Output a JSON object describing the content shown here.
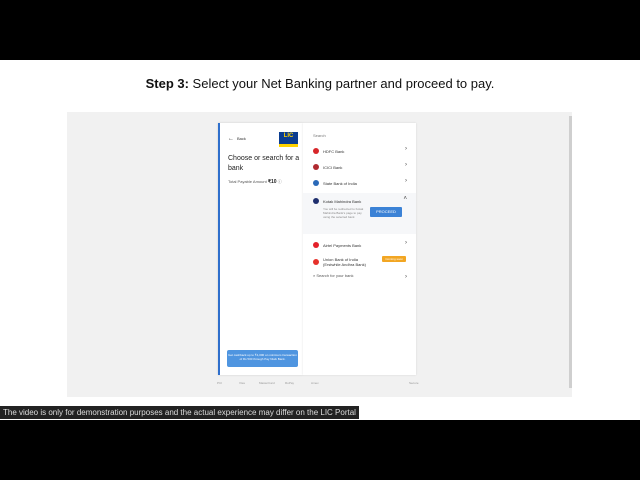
{
  "step": {
    "prefix": "Step 3:",
    "text": " Select your Net Banking partner and proceed to pay."
  },
  "left": {
    "back_label": "Back",
    "logo_text": "LIC",
    "title": "Choose or search for a bank",
    "amount_label": "Total Payable Amount",
    "amount_value": "₹10",
    "notice": "Get cashback up to ₹1,000 on minimum transaction of Rs 500 through Pay Ntwk Bank."
  },
  "right": {
    "section_label": "Search",
    "banks": [
      {
        "name": "HDFC Bank",
        "color": "#d7262a"
      },
      {
        "name": "ICICI Bank",
        "color": "#b02a30"
      },
      {
        "name": "State Bank of India",
        "color": "#2a69b8"
      },
      {
        "name": "Kotak Mahindra Bank",
        "color": "#1f2f6e"
      },
      {
        "name": "Airtel Payments Bank",
        "color": "#e4212a"
      },
      {
        "name": "Union Bank of India (Erstwhile Andhra Bank)",
        "color": "#e6312b"
      }
    ],
    "expanded_text": "You will be redirected to Kotak Mahindra Bank's page to pay using the selected bank",
    "proceed_label": "PROCEED",
    "coming_soon": "Coming soon",
    "search_label": "Search for your bank"
  },
  "footer_logos": [
    "PCI",
    "Visa",
    "MasterCard",
    "RuPay",
    "Amex",
    "Secure"
  ],
  "caption": "The video is only for demonstration purposes and the actual experience may differ on the LIC Portal"
}
